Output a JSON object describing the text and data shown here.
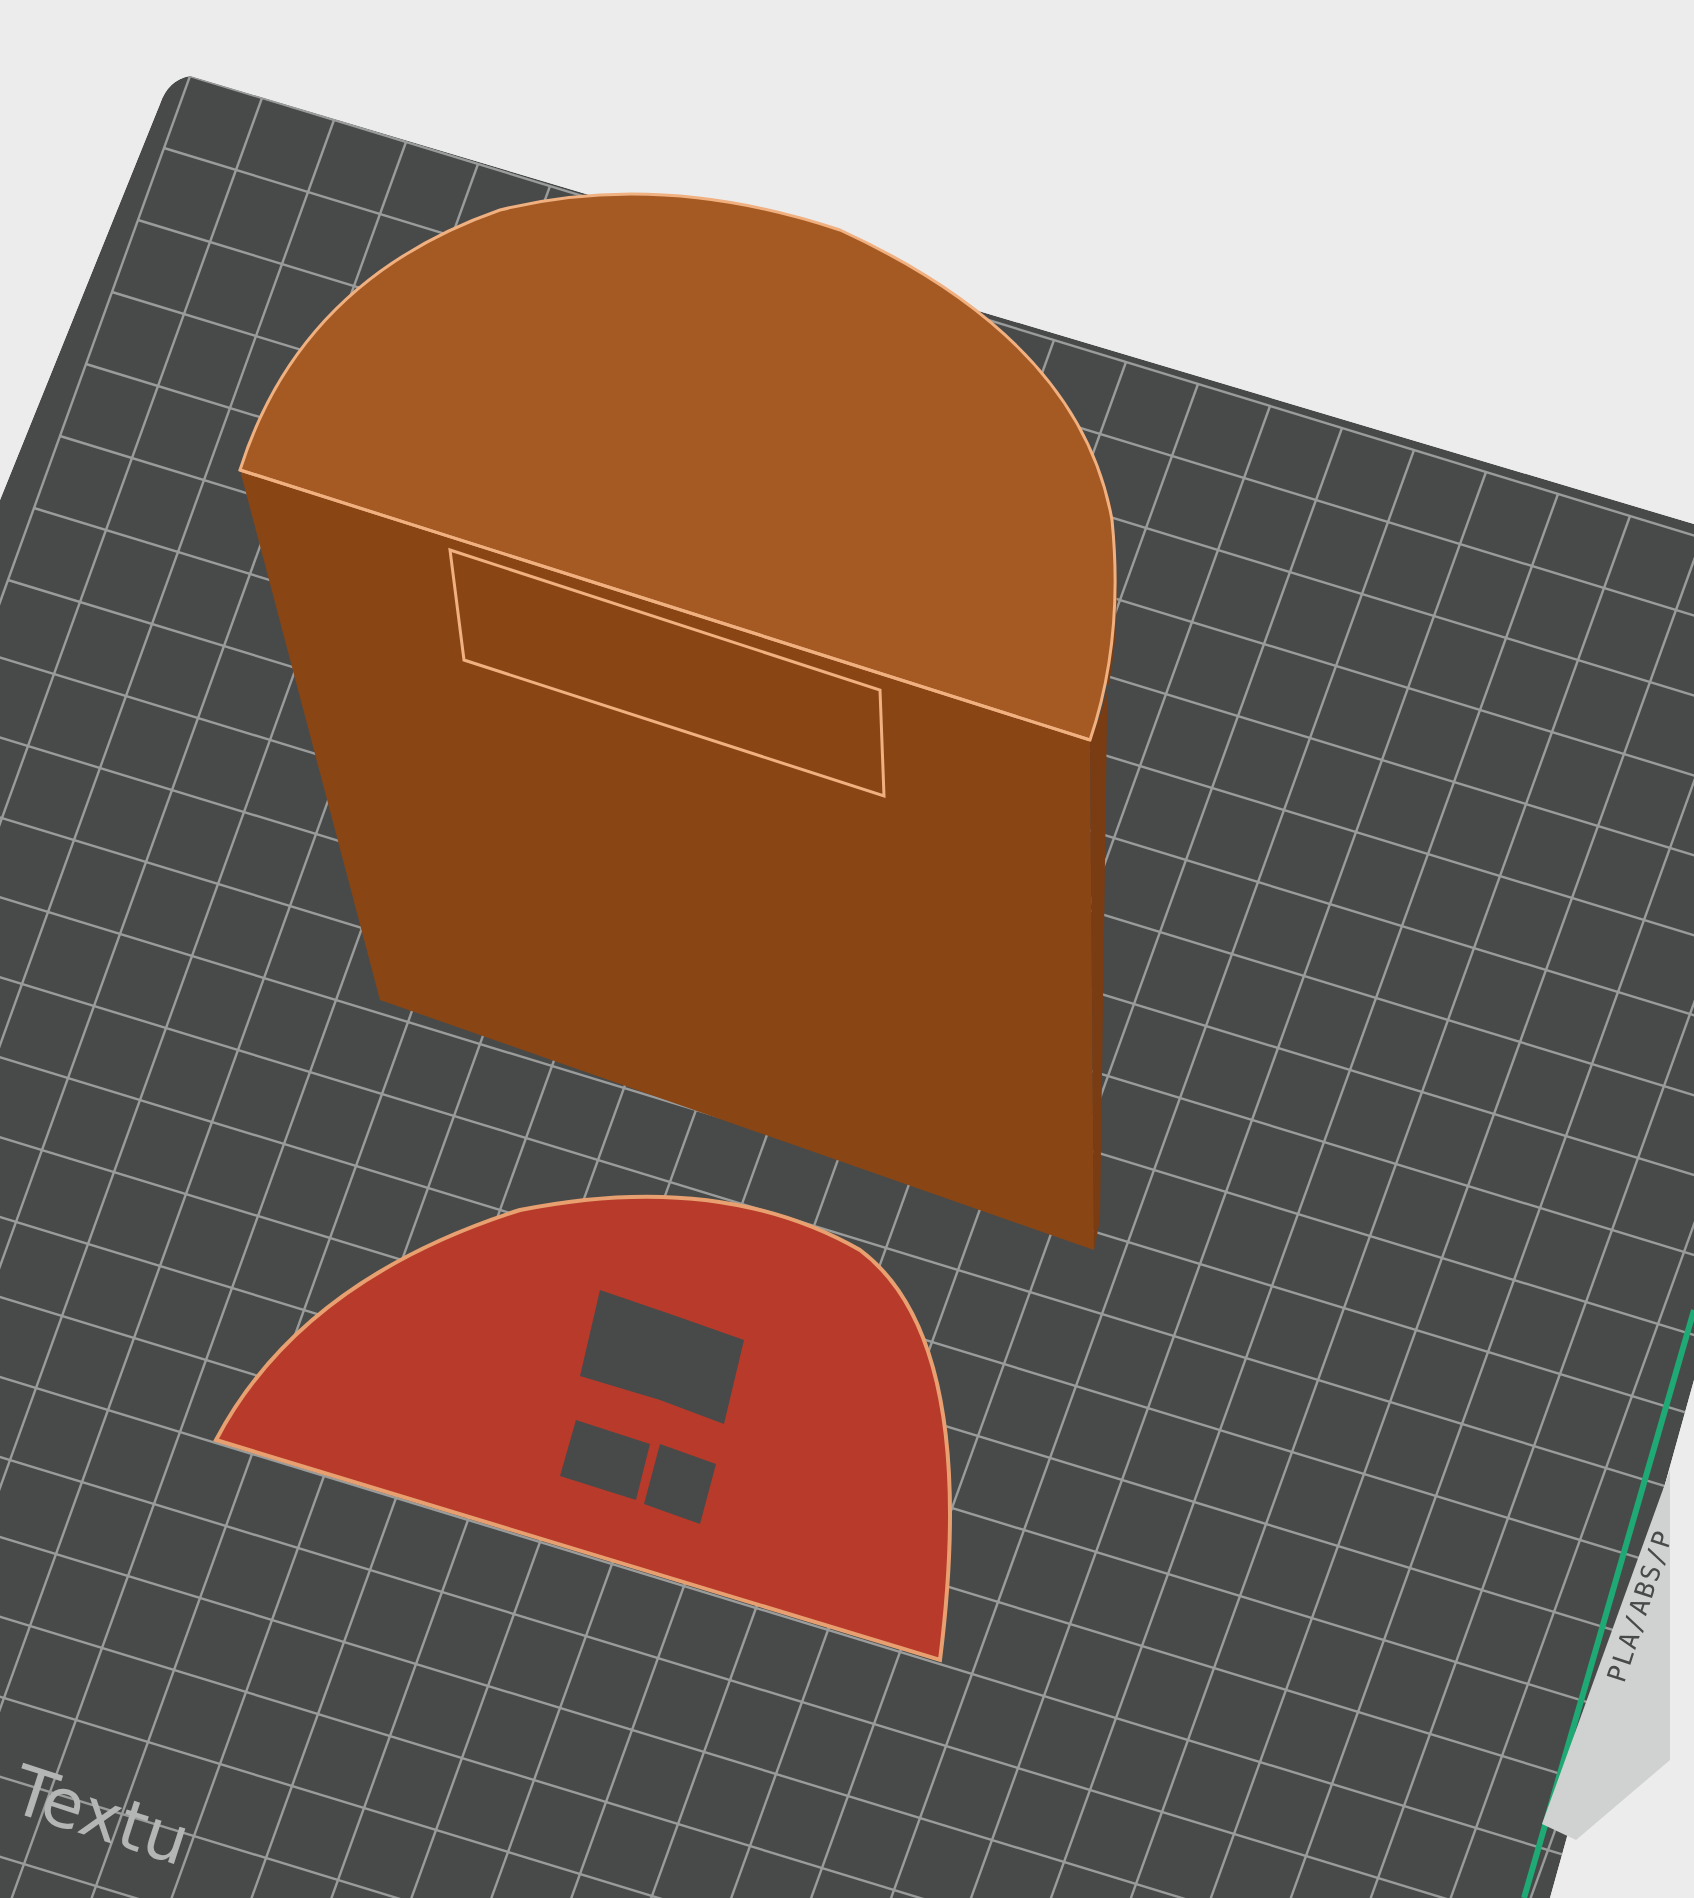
{
  "viewport": {
    "bed_texture_label": "Textu",
    "filament_label": "PLA/ABS/P"
  }
}
